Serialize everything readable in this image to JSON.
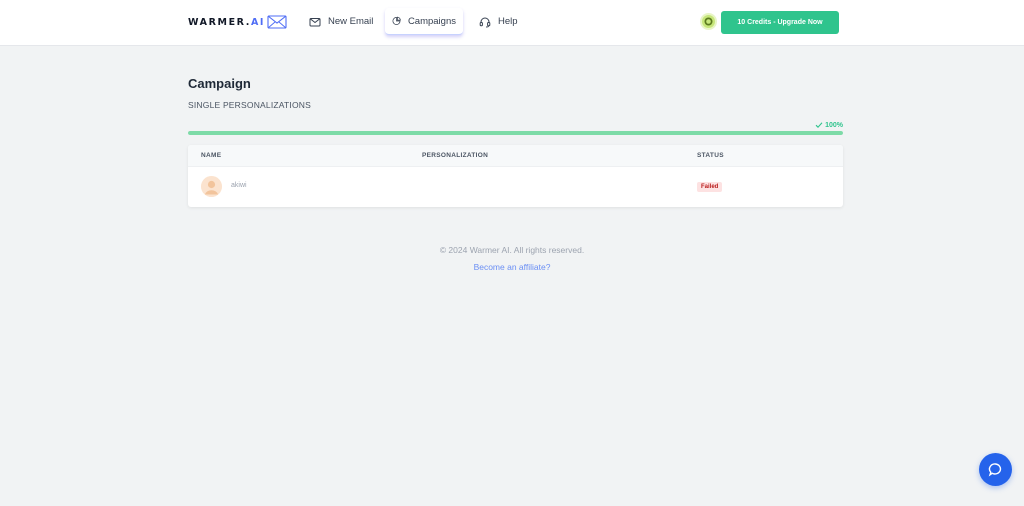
{
  "brand": {
    "name_prefix": "WARMER.",
    "name_suffix": "AI",
    "accent_color": "#4f6df5"
  },
  "nav": {
    "items": [
      {
        "label": "New Email",
        "icon": "mail-icon"
      },
      {
        "label": "Campaigns",
        "icon": "pie-chart-icon",
        "active": true
      },
      {
        "label": "Help",
        "icon": "headset-icon"
      }
    ]
  },
  "header": {
    "upgrade_label": "10 Credits - Upgrade Now",
    "upgrade_color": "#2fc48d"
  },
  "page": {
    "title": "Campaign",
    "subtitle": "SINGLE PERSONALIZATIONS"
  },
  "progress": {
    "label": "100%",
    "fraction": 1.0,
    "color": "#7ddba7"
  },
  "table": {
    "columns": [
      "NAME",
      "PERSONALIZATION",
      "STATUS"
    ],
    "rows": [
      {
        "name": "akiwi",
        "personalization": "",
        "status": "Failed"
      }
    ]
  },
  "footer": {
    "copyright": "© 2024 Warmer AI. All rights reserved.",
    "affiliate_link": "Become an affiliate?"
  }
}
